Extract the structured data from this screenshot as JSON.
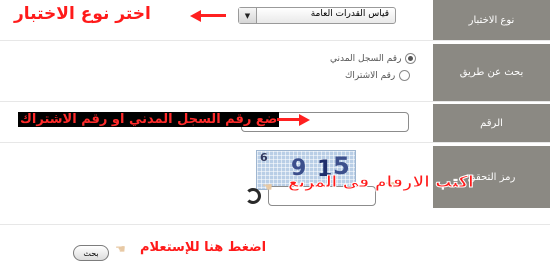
{
  "form": {
    "test_type_label": "نوع الاختبار",
    "test_type_value": "قياس القدرات العامة",
    "search_by_label": "بحث عن طريق",
    "radio_civil": "رقم السجل المدني",
    "radio_subscription": "رقم الاشتراك",
    "number_label": "الرقم",
    "verify_label": "رمز التحقق",
    "submit_button": "بحث"
  },
  "annotations": {
    "choose_test": "اختر نوع الاختبار",
    "enter_number": "ضع رقم السجل المدني او رقم الاشتراك",
    "write_digits": "اكتب الارقام في المربع",
    "click_here": "اضغط هنا للإستعلام"
  },
  "captcha": {
    "digits": [
      "6",
      "9",
      "1",
      "5"
    ],
    "color": "#3c4f8c"
  },
  "icons": {
    "dropdown": "triangle-down-icon",
    "refresh": "refresh-icon",
    "hand": "pointing-hand-icon"
  },
  "colors": {
    "label_bg": "#8b8983",
    "annotation_red": "#ff1a1a"
  }
}
